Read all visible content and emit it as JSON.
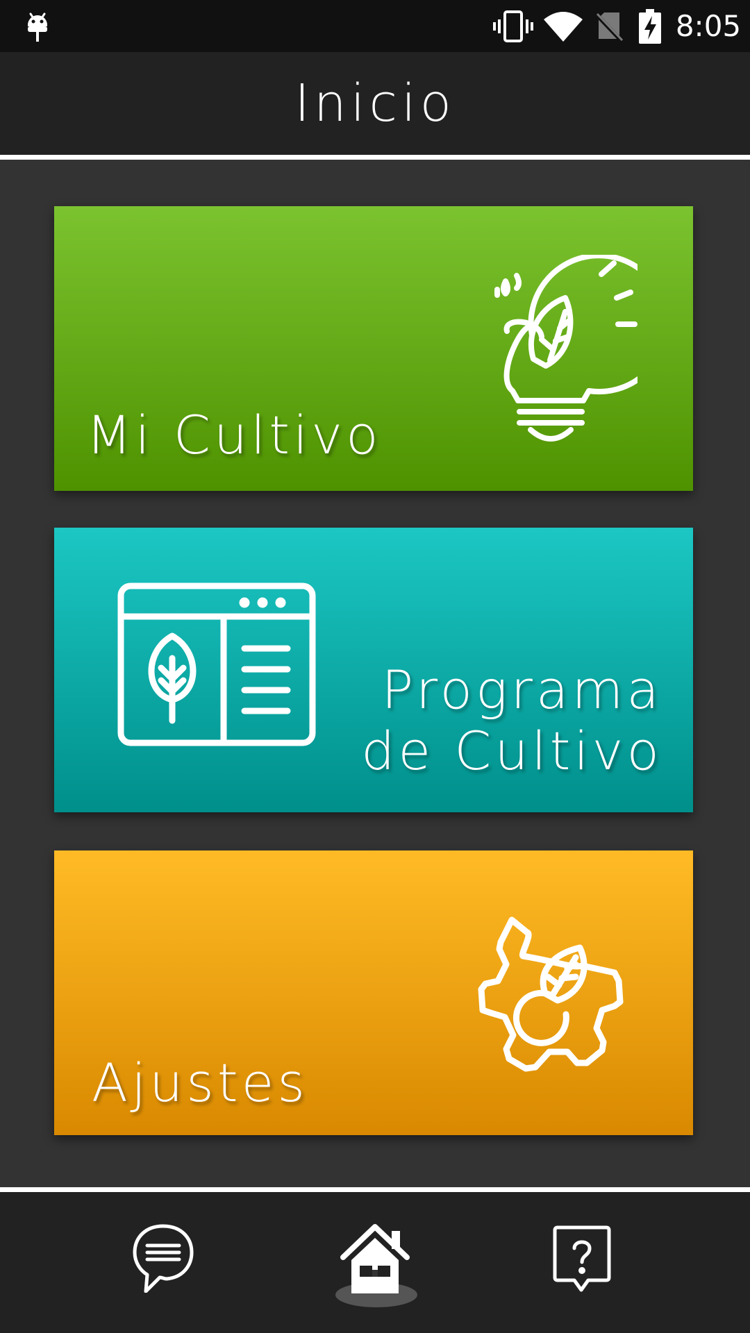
{
  "status_bar": {
    "time": "8:05",
    "icons": [
      "android-icon",
      "vibrate-icon",
      "wifi-icon",
      "no-sim-icon",
      "battery-charging-icon"
    ]
  },
  "app_bar": {
    "title": "Inicio"
  },
  "cards": {
    "mi_cultivo": {
      "label": "Mi Cultivo",
      "icon": "lightbulb-leaf-icon",
      "color": "#64ab18"
    },
    "programa": {
      "label_line1": "Programa",
      "label_line2": "de Cultivo",
      "icon": "browser-leaf-list-icon",
      "color": "#0ab0ad"
    },
    "ajustes": {
      "label": "Ajustes",
      "icon": "gear-leaf-icon",
      "color": "#f3a50e"
    }
  },
  "bottom_nav": {
    "items": [
      {
        "icon": "chat-bubble-icon",
        "active": false
      },
      {
        "icon": "home-icon",
        "active": true
      },
      {
        "icon": "help-bubble-icon",
        "active": false
      }
    ]
  },
  "colors": {
    "background": "#333333",
    "bars": "#222222",
    "divider": "#ffffff"
  }
}
